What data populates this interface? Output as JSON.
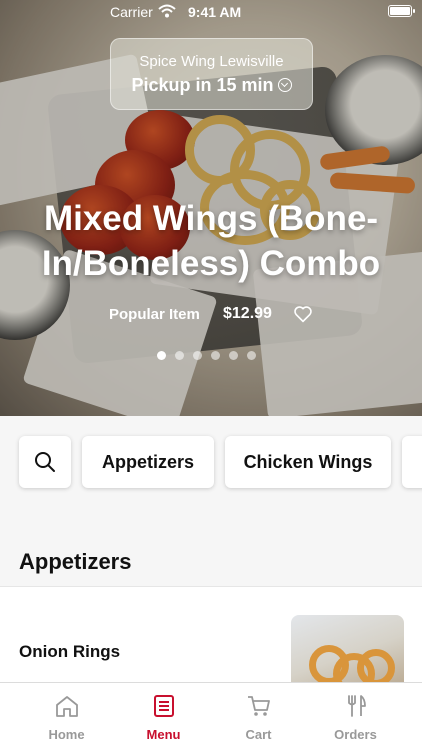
{
  "status": {
    "carrier": "Carrier",
    "time": "9:41 AM"
  },
  "store": {
    "name": "Spice Wing Lewisville",
    "pickup": "Pickup in 15 min"
  },
  "featured": {
    "title": "Mixed Wings (Bone-In/Boneless) Combo",
    "tag": "Popular Item",
    "price": "$12.99",
    "slide_count": 6,
    "active_slide": 1
  },
  "categories": [
    "Appetizers",
    "Chicken Wings"
  ],
  "section": {
    "title": "Appetizers",
    "items": [
      {
        "name": "Onion Rings"
      }
    ]
  },
  "tabs": [
    {
      "label": "Home",
      "icon": "home-icon",
      "active": false
    },
    {
      "label": "Menu",
      "icon": "menu-icon",
      "active": true
    },
    {
      "label": "Cart",
      "icon": "cart-icon",
      "active": false
    },
    {
      "label": "Orders",
      "icon": "orders-icon",
      "active": false
    }
  ],
  "colors": {
    "accent": "#c8102e",
    "tab_inactive": "#999999"
  }
}
